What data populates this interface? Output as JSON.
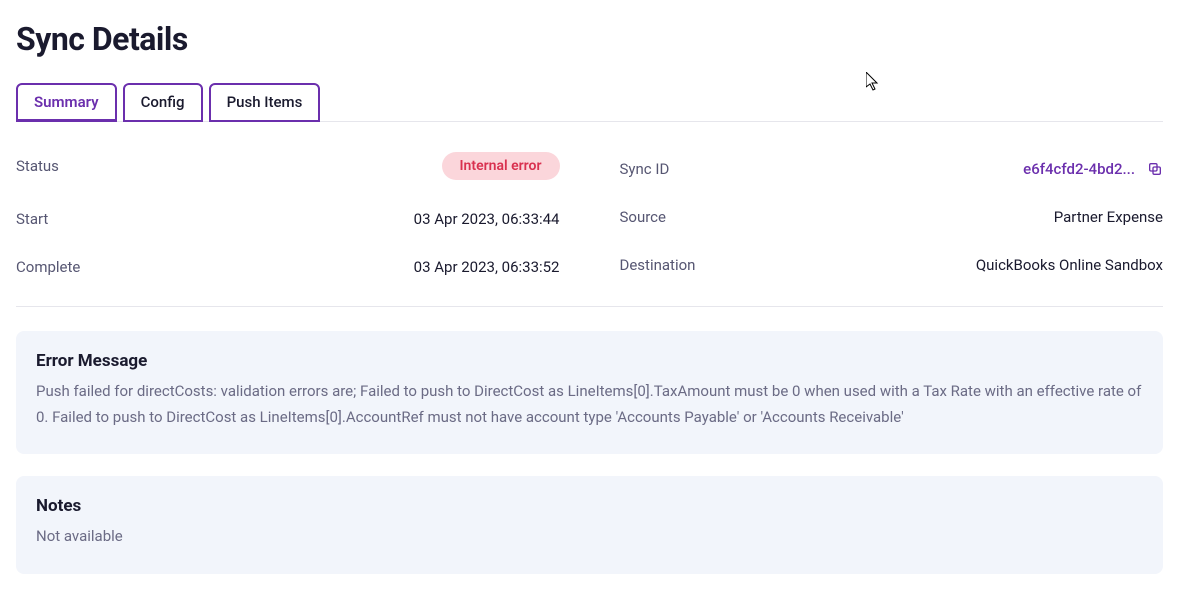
{
  "page_title": "Sync Details",
  "tabs": {
    "summary": "Summary",
    "config": "Config",
    "push_items": "Push Items"
  },
  "details": {
    "left": {
      "status_label": "Status",
      "status_value": "Internal error",
      "start_label": "Start",
      "start_value": "03 Apr 2023, 06:33:44",
      "complete_label": "Complete",
      "complete_value": "03 Apr 2023, 06:33:52"
    },
    "right": {
      "sync_id_label": "Sync ID",
      "sync_id_value": "e6f4cfd2-4bd2...",
      "source_label": "Source",
      "source_value": "Partner Expense",
      "destination_label": "Destination",
      "destination_value": "QuickBooks Online Sandbox"
    }
  },
  "error_panel": {
    "title": "Error Message",
    "body": "Push failed for directCosts: validation errors are; Failed to push to DirectCost as LineItems[0].TaxAmount must be 0 when used with a Tax Rate with an effective rate of 0. Failed to push to DirectCost as LineItems[0].AccountRef must not have account type 'Accounts Payable' or 'Accounts Receivable'"
  },
  "notes_panel": {
    "title": "Notes",
    "body": "Not available"
  }
}
